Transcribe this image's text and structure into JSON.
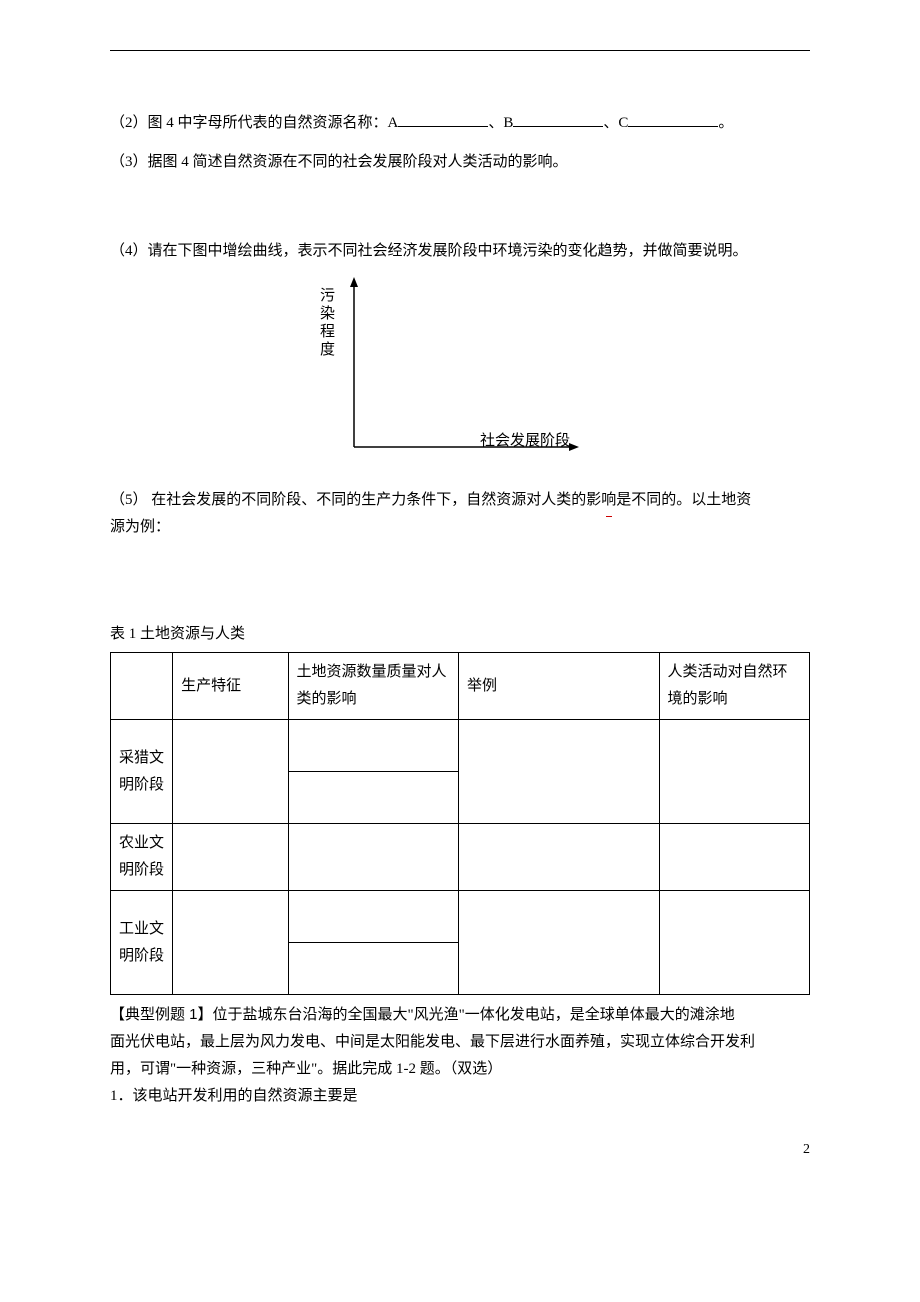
{
  "q2": {
    "prefix": "（2）图 4 中字母所代表的自然资源名称：A",
    "sep1": "、B",
    "sep2": "、C",
    "end": "。"
  },
  "q3": "（3）据图 4 简述自然资源在不同的社会发展阶段对人类活动的影响。",
  "q4": "（4）请在下图中增绘曲线，表示不同社会经济发展阶段中环境污染的变化趋势，并做简要说明。",
  "chart": {
    "ylabel": "污染程度",
    "xlabel": "社会发展阶段"
  },
  "q5": {
    "line1": "（5）  在社会发展的不同阶段、不同的生产力条件下，自然资源对人类的影",
    "wavy": "响",
    "line1_end": "是不同的。以土地资",
    "line2": "源为例："
  },
  "table": {
    "caption": "表 1  土地资源与人类",
    "headers": {
      "c1": "生产特征",
      "c2": "土地资源数量质量对人类的影响",
      "c3": "举例",
      "c4": "人类活动对自然环境的影响"
    },
    "rows": [
      {
        "label_l1": "采猎文",
        "label_l2": "明阶段"
      },
      {
        "label_l1": "农业文",
        "label_l2": "明阶段"
      },
      {
        "label_l1": "工业文",
        "label_l2": "明阶段"
      }
    ]
  },
  "example": {
    "title": "【典型例题 1】",
    "body_l1_a": "位于盐城东台沿海的全国最大\"风光渔\"一体化发电站，是全球单体最大的滩涂地",
    "body_l2": "面光伏电站，最上层为风力发电、中间是太阳能发电、最下层进行水面养殖，实现立体综合开发利",
    "body_l3": "用，可谓\"一种资源，三种产业\"。据此完成 1-2 题。（双选）",
    "q1": "1．该电站开发利用的自然资源主要是"
  },
  "chart_data": {
    "type": "line",
    "title": "",
    "xlabel": "社会发展阶段",
    "ylabel": "污染程度",
    "categories": [],
    "values": [],
    "note": "blank axes — user is asked to draw the curve"
  },
  "page_number": "2"
}
